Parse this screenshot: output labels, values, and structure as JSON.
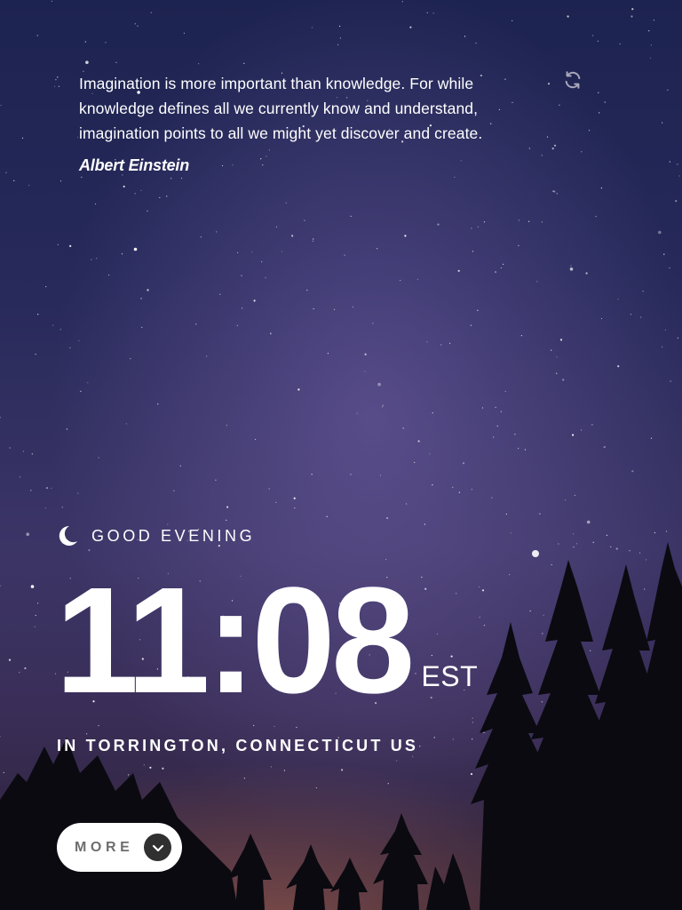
{
  "quote": {
    "text": "Imagination is more important than knowledge. For while knowledge defines all we currently know and understand, imagination points to all we might yet discover and create.",
    "author": "Albert Einstein",
    "refresh_icon": "refresh-icon"
  },
  "greeting": {
    "icon": "moon-icon",
    "text": "GOOD EVENING"
  },
  "clock": {
    "time": "11:08",
    "timezone": "EST"
  },
  "location": {
    "text": "IN TORRINGTON, CONNECTICUT US"
  },
  "more_button": {
    "label": "MORE",
    "icon": "chevron-down-icon"
  },
  "colors": {
    "text": "#ffffff",
    "button_bg": "#ffffff",
    "button_text": "#6e6e6e",
    "chevron_bg": "#303030"
  }
}
